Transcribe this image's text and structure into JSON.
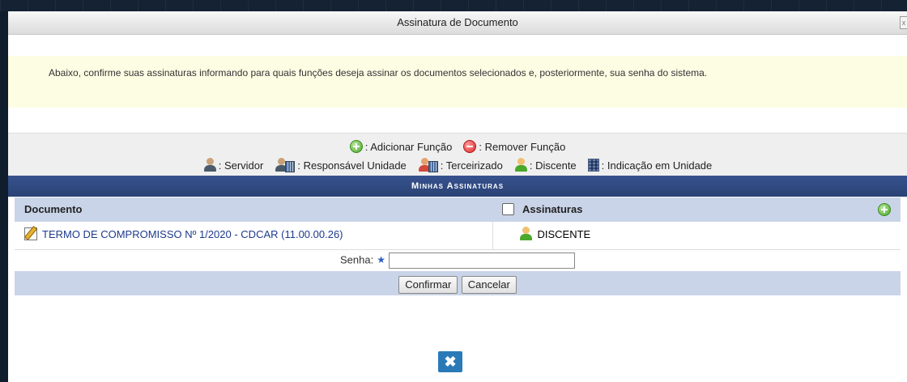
{
  "dialog": {
    "title": "Assinatura de Documento",
    "close_corner": "x"
  },
  "info": {
    "message": "Abaixo, confirme suas assinaturas informando para quais funções deseja assinar os documentos selecionados e, posteriormente, sua senha do sistema."
  },
  "legend": {
    "add": ": Adicionar Função",
    "remove": ": Remover Função",
    "servidor": ": Servidor",
    "responsavel": ": Responsável Unidade",
    "terceirizado": ": Terceirizado",
    "discente": ": Discente",
    "indicacao": ": Indicação em Unidade"
  },
  "panel": {
    "caption": "Minhas Assinaturas",
    "headers": {
      "documento": "Documento",
      "assinaturas": "Assinaturas"
    },
    "rows": [
      {
        "documento": "TERMO DE COMPROMISSO Nº 1/2020 - CDCAR (11.00.00.26)",
        "assinatura": "DISCENTE"
      }
    ],
    "senha_label": "Senha:",
    "senha_value": "",
    "confirm_label": "Confirmar",
    "cancel_label": "Cancelar"
  },
  "close_button_glyph": "✖",
  "colors": {
    "caption_bg": "#2a4375",
    "header_bg": "#c9d4e8",
    "info_bg": "#fdfde4",
    "link": "#1d3a8c",
    "close_button": "#2a7ab8"
  }
}
